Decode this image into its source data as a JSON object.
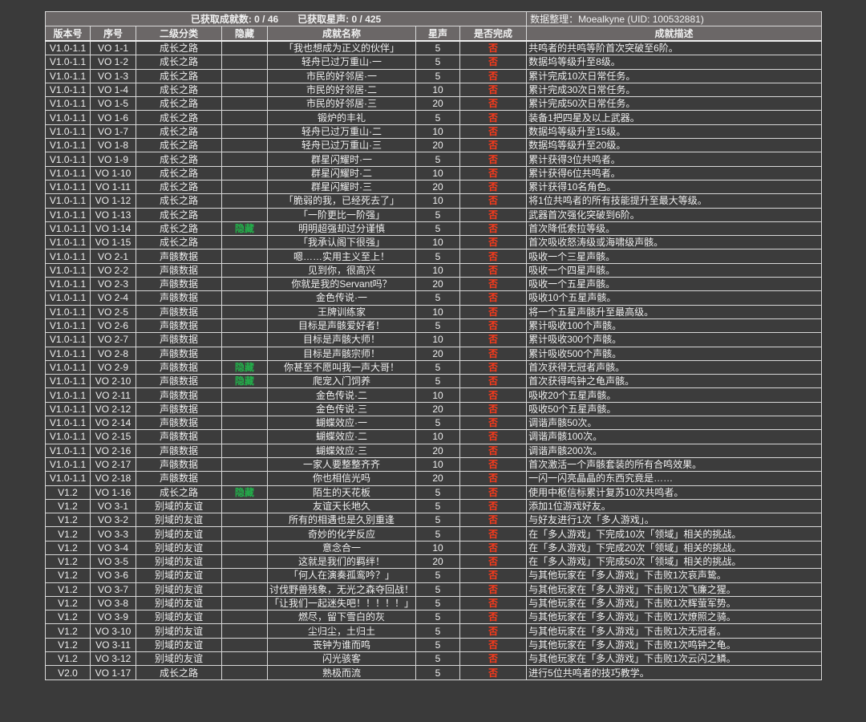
{
  "summary": {
    "stats": "已获取成就数: 0 / 46　　已获取星声: 0 / 425",
    "credit": "数据整理：Moealkyne (UID: 100532881)"
  },
  "headers": [
    "版本号",
    "序号",
    "二级分类",
    "隐藏",
    "成就名称",
    "星声",
    "是否完成",
    "成就描述"
  ],
  "colors": {
    "not_done": "#ff3a1a",
    "hidden": "#22b04a",
    "header_bg": "#6b6767",
    "cell_bg": "#3c3c3c"
  },
  "rows": [
    [
      "V1.0-1.1",
      "VO 1-1",
      "成长之路",
      "",
      "「我也想成为正义的伙伴」",
      "5",
      "否",
      "共鸣者的共鸣等阶首次突破至6阶。"
    ],
    [
      "V1.0-1.1",
      "VO 1-2",
      "成长之路",
      "",
      "轻舟已过万重山·一",
      "5",
      "否",
      "数据坞等级升至8级。"
    ],
    [
      "V1.0-1.1",
      "VO 1-3",
      "成长之路",
      "",
      "市民的好邻居·一",
      "5",
      "否",
      "累计完成10次日常任务。"
    ],
    [
      "V1.0-1.1",
      "VO 1-4",
      "成长之路",
      "",
      "市民的好邻居·二",
      "10",
      "否",
      "累计完成30次日常任务。"
    ],
    [
      "V1.0-1.1",
      "VO 1-5",
      "成长之路",
      "",
      "市民的好邻居·三",
      "20",
      "否",
      "累计完成50次日常任务。"
    ],
    [
      "V1.0-1.1",
      "VO 1-6",
      "成长之路",
      "",
      "锻炉的丰礼",
      "5",
      "否",
      "装备1把四星及以上武器。"
    ],
    [
      "V1.0-1.1",
      "VO 1-7",
      "成长之路",
      "",
      "轻舟已过万重山·二",
      "10",
      "否",
      "数据坞等级升至15级。"
    ],
    [
      "V1.0-1.1",
      "VO 1-8",
      "成长之路",
      "",
      "轻舟已过万重山·三",
      "20",
      "否",
      "数据坞等级升至20级。"
    ],
    [
      "V1.0-1.1",
      "VO 1-9",
      "成长之路",
      "",
      "群星闪耀时·一",
      "5",
      "否",
      "累计获得3位共鸣者。"
    ],
    [
      "V1.0-1.1",
      "VO 1-10",
      "成长之路",
      "",
      "群星闪耀时·二",
      "10",
      "否",
      "累计获得6位共鸣者。"
    ],
    [
      "V1.0-1.1",
      "VO 1-11",
      "成长之路",
      "",
      "群星闪耀时·三",
      "20",
      "否",
      "累计获得10名角色。"
    ],
    [
      "V1.0-1.1",
      "VO 1-12",
      "成长之路",
      "",
      "「脆弱的我，已经死去了」",
      "10",
      "否",
      "将1位共鸣者的所有技能提升至最大等级。"
    ],
    [
      "V1.0-1.1",
      "VO 1-13",
      "成长之路",
      "",
      "「一阶更比一阶强」",
      "5",
      "否",
      "武器首次强化突破到6阶。"
    ],
    [
      "V1.0-1.1",
      "VO 1-14",
      "成长之路",
      "隐藏",
      "明明超强却过分谨慎",
      "5",
      "否",
      "首次降低索拉等级。"
    ],
    [
      "V1.0-1.1",
      "VO 1-15",
      "成长之路",
      "",
      "「我承认阁下很强」",
      "10",
      "否",
      "首次吸收怒涛级或海啸级声骸。"
    ],
    [
      "V1.0-1.1",
      "VO 2-1",
      "声骸数据",
      "",
      "嗯……实用主义至上！",
      "5",
      "否",
      "吸收一个三星声骸。"
    ],
    [
      "V1.0-1.1",
      "VO 2-2",
      "声骸数据",
      "",
      "见到你，很高兴",
      "10",
      "否",
      "吸收一个四星声骸。"
    ],
    [
      "V1.0-1.1",
      "VO 2-3",
      "声骸数据",
      "",
      "你就是我的Servant吗？",
      "20",
      "否",
      "吸收一个五星声骸。"
    ],
    [
      "V1.0-1.1",
      "VO 2-4",
      "声骸数据",
      "",
      "金色传说·一",
      "5",
      "否",
      "吸收10个五星声骸。"
    ],
    [
      "V1.0-1.1",
      "VO 2-5",
      "声骸数据",
      "",
      "王牌训练家",
      "10",
      "否",
      "将一个五星声骸升至最高级。"
    ],
    [
      "V1.0-1.1",
      "VO 2-6",
      "声骸数据",
      "",
      "目标是声骸爱好者！",
      "5",
      "否",
      "累计吸收100个声骸。"
    ],
    [
      "V1.0-1.1",
      "VO 2-7",
      "声骸数据",
      "",
      "目标是声骸大师！",
      "10",
      "否",
      "累计吸收300个声骸。"
    ],
    [
      "V1.0-1.1",
      "VO 2-8",
      "声骸数据",
      "",
      "目标是声骸宗师！",
      "20",
      "否",
      "累计吸收500个声骸。"
    ],
    [
      "V1.0-1.1",
      "VO 2-9",
      "声骸数据",
      "隐藏",
      "你甚至不愿叫我一声大哥！",
      "5",
      "否",
      "首次获得无冠者声骸。"
    ],
    [
      "V1.0-1.1",
      "VO 2-10",
      "声骸数据",
      "隐藏",
      "爬宠入门饲养",
      "5",
      "否",
      "首次获得鸣钟之龟声骸。"
    ],
    [
      "V1.0-1.1",
      "VO 2-11",
      "声骸数据",
      "",
      "金色传说·二",
      "10",
      "否",
      "吸收20个五星声骸。"
    ],
    [
      "V1.0-1.1",
      "VO 2-12",
      "声骸数据",
      "",
      "金色传说·三",
      "20",
      "否",
      "吸收50个五星声骸。"
    ],
    [
      "V1.0-1.1",
      "VO 2-14",
      "声骸数据",
      "",
      "蝴蝶效应·一",
      "5",
      "否",
      "调谐声骸50次。"
    ],
    [
      "V1.0-1.1",
      "VO 2-15",
      "声骸数据",
      "",
      "蝴蝶效应·二",
      "10",
      "否",
      "调谐声骸100次。"
    ],
    [
      "V1.0-1.1",
      "VO 2-16",
      "声骸数据",
      "",
      "蝴蝶效应·三",
      "20",
      "否",
      "调谐声骸200次。"
    ],
    [
      "V1.0-1.1",
      "VO 2-17",
      "声骸数据",
      "",
      "一家人要整整齐齐",
      "10",
      "否",
      "首次激活一个声骸套装的所有合鸣效果。"
    ],
    [
      "V1.0-1.1",
      "VO 2-18",
      "声骸数据",
      "",
      "你也相信光吗",
      "20",
      "否",
      "一闪一闪亮晶晶的东西究竟是……"
    ],
    [
      "V1.2",
      "VO 1-16",
      "成长之路",
      "隐藏",
      "陌生的天花板",
      "5",
      "否",
      "使用中枢信标累计复苏10次共鸣者。"
    ],
    [
      "V1.2",
      "VO 3-1",
      "别域的友谊",
      "",
      "友谊天长地久",
      "5",
      "否",
      "添加1位游戏好友。"
    ],
    [
      "V1.2",
      "VO 3-2",
      "别域的友谊",
      "",
      "所有的相遇也是久别重逢",
      "5",
      "否",
      "与好友进行1次「多人游戏」。"
    ],
    [
      "V1.2",
      "VO 3-3",
      "别域的友谊",
      "",
      "奇妙的化学反应",
      "5",
      "否",
      "在「多人游戏」下完成10次「领域」相关的挑战。"
    ],
    [
      "V1.2",
      "VO 3-4",
      "别域的友谊",
      "",
      "意念合一",
      "10",
      "否",
      "在「多人游戏」下完成20次「领域」相关的挑战。"
    ],
    [
      "V1.2",
      "VO 3-5",
      "别域的友谊",
      "",
      "这就是我们的羁绊！",
      "20",
      "否",
      "在「多人游戏」下完成50次「领域」相关的挑战。"
    ],
    [
      "V1.2",
      "VO 3-6",
      "别域的友谊",
      "",
      "「何人在演奏孤鸾吟？」",
      "5",
      "否",
      "与其他玩家在「多人游戏」下击败1次哀声鸷。"
    ],
    [
      "V1.2",
      "VO 3-7",
      "别域的友谊",
      "",
      "讨伐野兽残象，无光之森夺回战！",
      "5",
      "否",
      "与其他玩家在「多人游戏」下击败1次飞廉之猩。"
    ],
    [
      "V1.2",
      "VO 3-8",
      "别域的友谊",
      "",
      "「让我们一起迷失吧！！！！！」",
      "5",
      "否",
      "与其他玩家在「多人游戏」下击败1次辉萤军势。"
    ],
    [
      "V1.2",
      "VO 3-9",
      "别域的友谊",
      "",
      "燃尽，留下雪白的灰",
      "5",
      "否",
      "与其他玩家在「多人游戏」下击败1次燎照之骑。"
    ],
    [
      "V1.2",
      "VO 3-10",
      "别域的友谊",
      "",
      "尘归尘，土归土",
      "5",
      "否",
      "与其他玩家在「多人游戏」下击败1次无冠者。"
    ],
    [
      "V1.2",
      "VO 3-11",
      "别域的友谊",
      "",
      "丧钟为谁而鸣",
      "5",
      "否",
      "与其他玩家在「多人游戏」下击败1次鸣钟之龟。"
    ],
    [
      "V1.2",
      "VO 3-12",
      "别域的友谊",
      "",
      "闪光骇客",
      "5",
      "否",
      "与其他玩家在「多人游戏」下击败1次云闪之鳞。"
    ],
    [
      "V2.0",
      "VO 1-17",
      "成长之路",
      "",
      "熟极而流",
      "5",
      "否",
      "进行5位共鸣者的技巧教学。"
    ]
  ]
}
